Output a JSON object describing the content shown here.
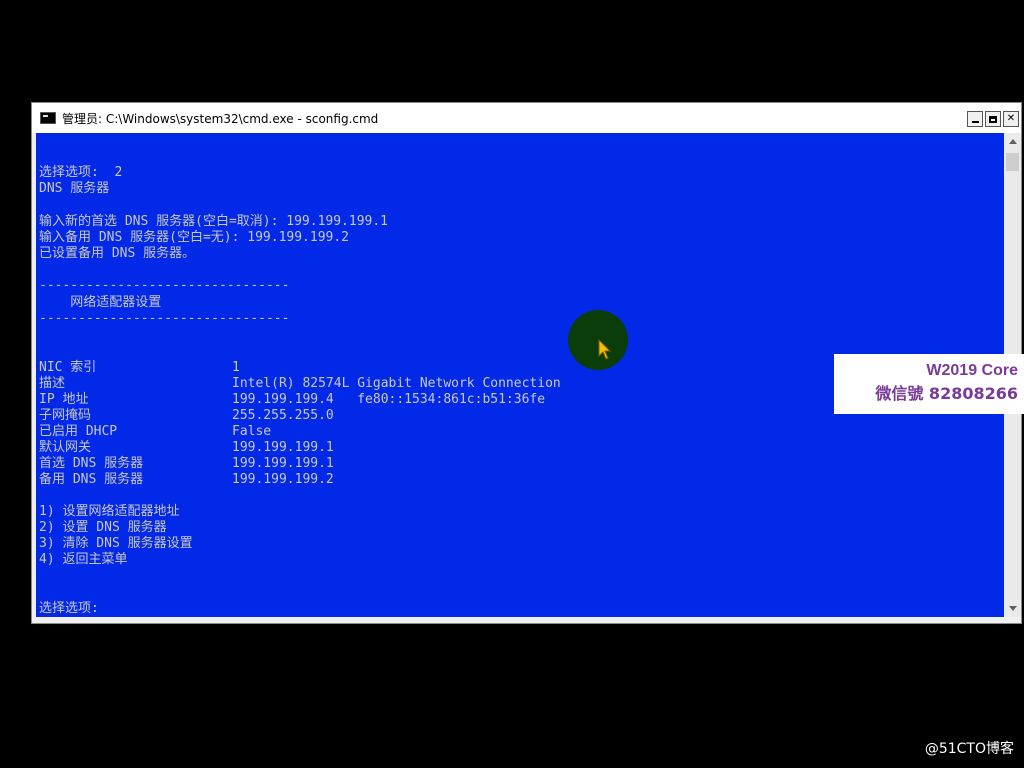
{
  "window": {
    "title": "管理员: C:\\Windows\\system32\\cmd.exe - sconfig.cmd",
    "app_icon": "cmd-icon",
    "controls": {
      "minimize": "minimize-icon",
      "maximize": "maximize-icon",
      "close": "close-icon"
    }
  },
  "console": {
    "bg_color": "#0329e8",
    "text_color": "#c8c8c8",
    "lines": {
      "l1": "选择选项:  2",
      "l2": "DNS 服务器",
      "l3": "输入新的首选 DNS 服务器(空白=取消): 199.199.199.1",
      "l4": "输入备用 DNS 服务器(空白=无): 199.199.199.2",
      "l5": "已设置备用 DNS 服务器。",
      "sep1": "--------------------------------",
      "heading": "    网络适配器设置",
      "sep2": "--------------------------------",
      "prompt": "选择选项: "
    },
    "adapter": [
      {
        "label": "NIC 索引",
        "value": "1"
      },
      {
        "label": "描述",
        "value": "Intel(R) 82574L Gigabit Network Connection"
      },
      {
        "label": "IP 地址",
        "value": "199.199.199.4   fe80::1534:861c:b51:36fe"
      },
      {
        "label": "子网掩码",
        "value": "255.255.255.0"
      },
      {
        "label": "已启用 DHCP",
        "value": "False"
      },
      {
        "label": "默认网关",
        "value": "199.199.199.1"
      },
      {
        "label": "首选 DNS 服务器",
        "value": "199.199.199.1"
      },
      {
        "label": "备用 DNS 服务器",
        "value": "199.199.199.2"
      }
    ],
    "menu": [
      "1) 设置网络适配器地址",
      "2) 设置 DNS 服务器",
      "3) 清除 DNS 服务器设置",
      "4) 返回主菜单"
    ]
  },
  "watermark": {
    "line1": "W2019 Core",
    "line2": "微信號 82808266"
  },
  "corner_mark": "@51CTO博客"
}
